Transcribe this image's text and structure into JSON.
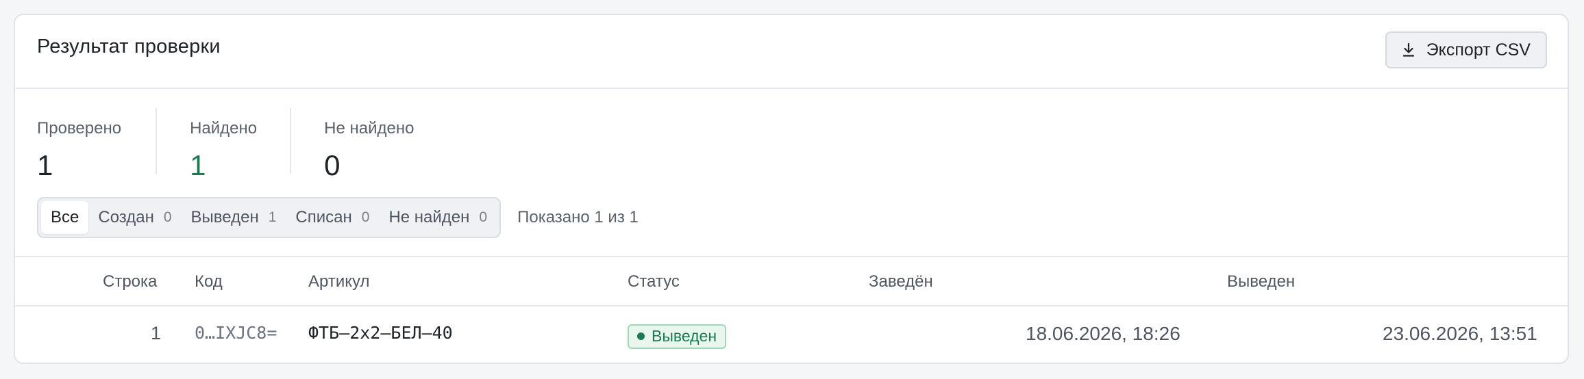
{
  "header": {
    "title": "Результат проверки",
    "export_label": "Экспорт CSV",
    "export_icon": "download-icon"
  },
  "stats": [
    {
      "label": "Проверено",
      "value": "1"
    },
    {
      "label": "Найдено",
      "value": "1",
      "color": "#1b7a52"
    },
    {
      "label": "Не найдено",
      "value": "0"
    }
  ],
  "filters": {
    "items": [
      {
        "label": "Все",
        "count": "",
        "active": true
      },
      {
        "label": "Создан",
        "count": "0"
      },
      {
        "label": "Выведен",
        "count": "1"
      },
      {
        "label": "Списан",
        "count": "0"
      },
      {
        "label": "Не найден",
        "count": "0"
      }
    ],
    "shown_text": "Показано 1 из 1"
  },
  "table": {
    "columns": [
      "Строка",
      "Код",
      "Артикул",
      "Статус",
      "Заведён",
      "Выведен"
    ],
    "rows": [
      {
        "line": "1",
        "code": "0…IXJC8=",
        "article": "ФТБ–2х2–БЕЛ–40",
        "status": "Выведен",
        "created": "18.06.2026, 18:26",
        "withdrawn": "23.06.2026, 13:51"
      }
    ]
  },
  "colors": {
    "accent_green": "#1b7a52",
    "badge_bg": "#e8f6ee",
    "badge_border": "#9fd6b8"
  }
}
